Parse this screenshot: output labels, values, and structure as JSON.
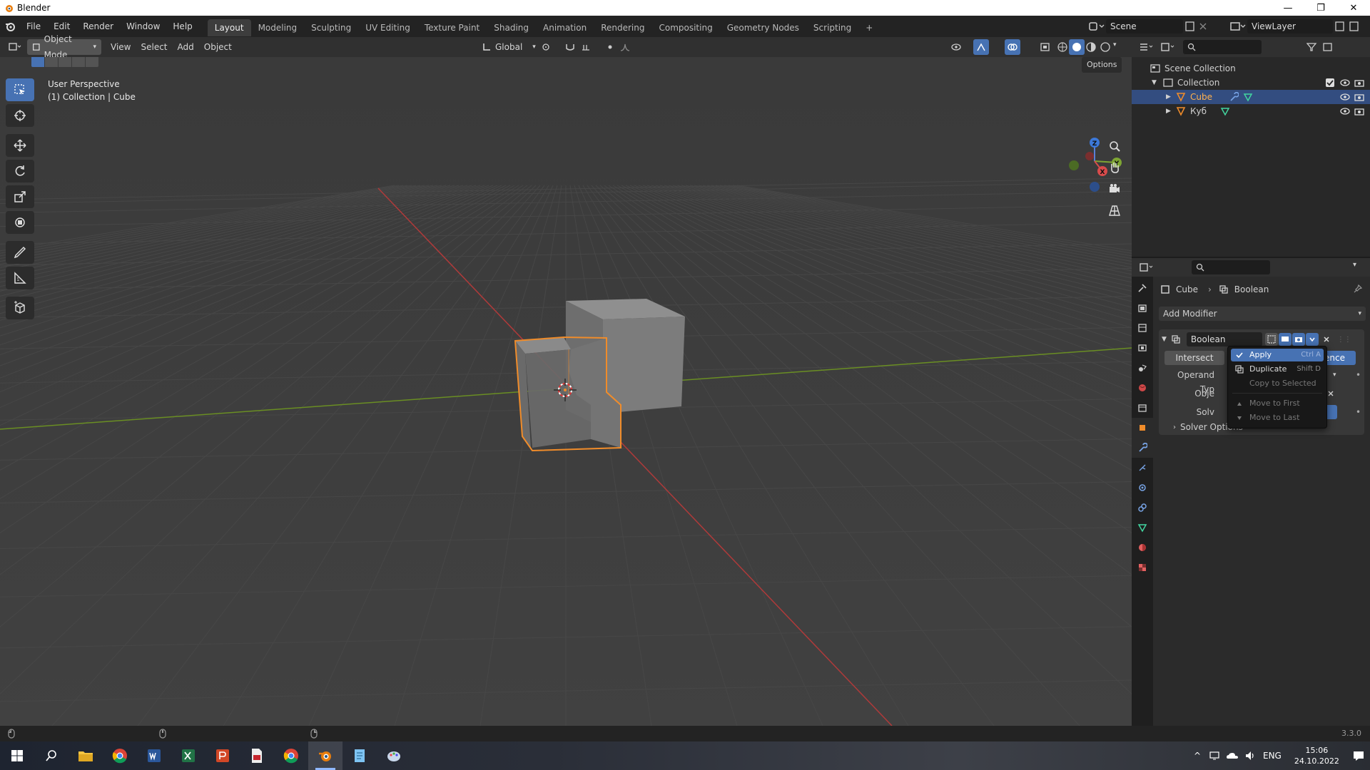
{
  "window": {
    "title": "Blender",
    "controls": [
      "—",
      "❐",
      "✕"
    ]
  },
  "menu": {
    "items": [
      "File",
      "Edit",
      "Render",
      "Window",
      "Help"
    ],
    "workspaces": [
      "Layout",
      "Modeling",
      "Sculpting",
      "UV Editing",
      "Texture Paint",
      "Shading",
      "Animation",
      "Rendering",
      "Compositing",
      "Geometry Nodes",
      "Scripting",
      "+"
    ],
    "active_workspace": "Layout",
    "scene": "Scene",
    "view_layer": "ViewLayer"
  },
  "viewport_header": {
    "mode": "Object Mode",
    "menus": [
      "View",
      "Select",
      "Add",
      "Object"
    ],
    "orientation": "Global",
    "options": "Options"
  },
  "viewport": {
    "perspective": "User Perspective",
    "context": "(1) Collection | Cube",
    "gizmo_axes": {
      "z": "Z",
      "y": "Y",
      "x": "X"
    }
  },
  "outliner": {
    "root": "Scene Collection",
    "collection": "Collection",
    "objects": [
      {
        "name": "Cube",
        "selected": true
      },
      {
        "name": "Куб",
        "selected": false
      }
    ]
  },
  "properties": {
    "breadcrumb": {
      "object": "Cube",
      "modifier": "Boolean"
    },
    "add_modifier": "Add Modifier",
    "modifier": {
      "name": "Boolean",
      "operations": [
        "Intersect",
        "ence"
      ],
      "operand_type_label": "Operand Typ",
      "object_label": "Obje",
      "solver_label": "Solv",
      "solver_options": "Solver Options"
    }
  },
  "context_menu": {
    "items": [
      {
        "label": "Apply",
        "shortcut": "Ctrl A",
        "state": "highlight"
      },
      {
        "label": "Duplicate",
        "shortcut": "Shift D",
        "state": "normal"
      },
      {
        "label": "Copy to Selected",
        "shortcut": "",
        "state": "disabled"
      },
      {
        "label": "Move to First",
        "shortcut": "",
        "state": "disabled"
      },
      {
        "label": "Move to Last",
        "shortcut": "",
        "state": "disabled"
      }
    ]
  },
  "statusbar": {
    "version": "3.3.0"
  },
  "taskbar": {
    "apps": [
      "windows-start",
      "search",
      "file-explorer",
      "chrome",
      "word",
      "excel",
      "powerpoint",
      "acrobat",
      "chrome-2",
      "blender",
      "notepad",
      "paint"
    ],
    "active_app": "blender",
    "lang": "ENG",
    "time": "15:06",
    "date": "24.10.2022"
  },
  "colors": {
    "accent": "#4772b3",
    "selection_orange": "#f08c2a",
    "axis_x": "#b03a3a",
    "axis_y": "#6a8e23"
  }
}
